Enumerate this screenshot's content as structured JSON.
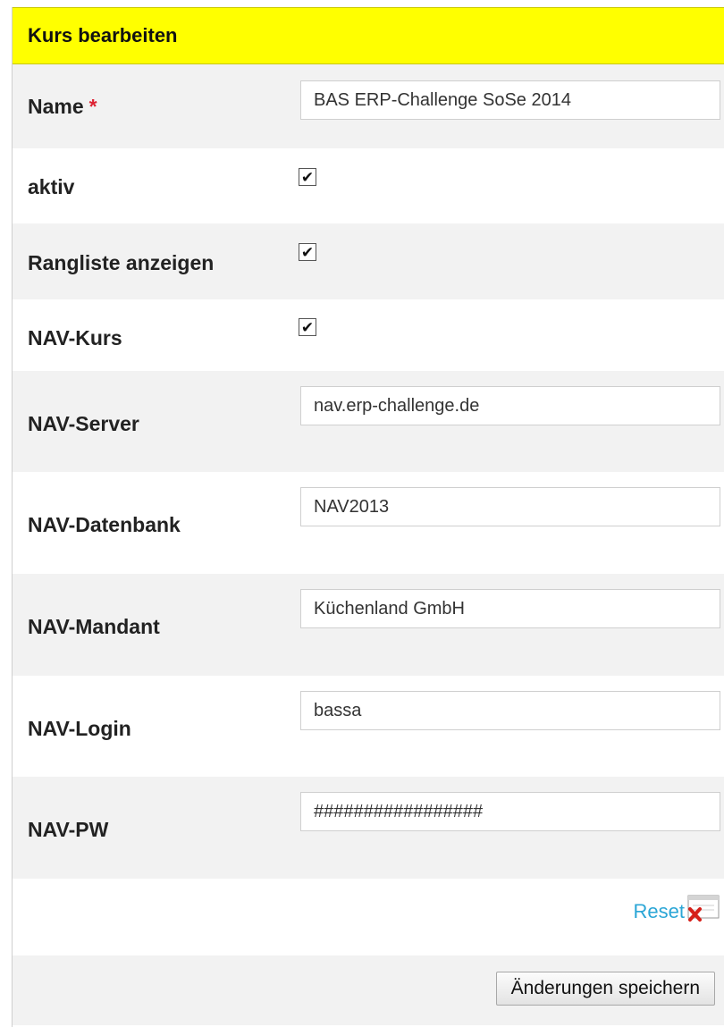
{
  "form": {
    "title": "Kurs bearbeiten",
    "required_marker": "*",
    "fields": {
      "name": {
        "label": "Name",
        "value": "BAS ERP-Challenge SoSe 2014"
      },
      "aktiv": {
        "label": "aktiv",
        "checked": true
      },
      "rangliste": {
        "label": "Rangliste anzeigen",
        "checked": true
      },
      "nav_kurs": {
        "label": "NAV-Kurs",
        "checked": true
      },
      "nav_server": {
        "label": "NAV-Server",
        "value": "nav.erp-challenge.de"
      },
      "nav_datenbank": {
        "label": "NAV-Datenbank",
        "value": "NAV2013"
      },
      "nav_mandant": {
        "label": "NAV-Mandant",
        "value": "Küchenland GmbH"
      },
      "nav_login": {
        "label": "NAV-Login",
        "value": "bassa"
      },
      "nav_pw": {
        "label": "NAV-PW",
        "value": "#################"
      }
    },
    "check_glyph": "✔",
    "reset_label": "Reset",
    "save_label": "Änderungen speichern"
  },
  "colors": {
    "header_bg": "#ffff00",
    "row_gray": "#f2f2f2",
    "link": "#2ba6d6",
    "required": "#dd2233"
  },
  "icons": {
    "reset": "delete-document-icon"
  }
}
